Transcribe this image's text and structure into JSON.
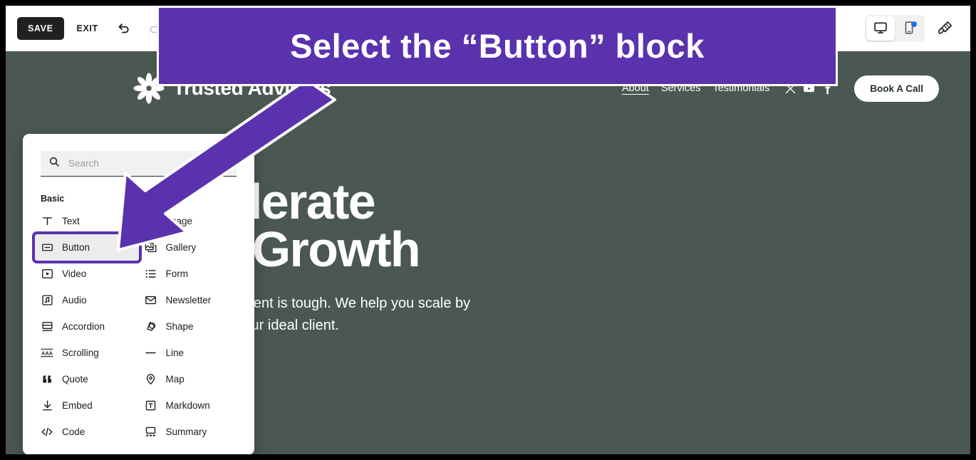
{
  "callout": {
    "text": "Select the “Button” block",
    "bg_color": "#5a32ad",
    "text_color": "#ffffff"
  },
  "toolbar": {
    "save_label": "SAVE",
    "exit_label": "EXIT",
    "undo_icon": "undo-icon",
    "redo_icon": "redo-icon",
    "redo_state": "disabled",
    "desktop_icon": "desktop-icon",
    "mobile_icon": "mobile-icon",
    "mobile_badge_color": "#1a73e8",
    "brush_icon": "paintbrush-icon",
    "active_device": "desktop"
  },
  "site": {
    "bg_color": "#4b5852",
    "logo": {
      "mark": "asterisk-flower-icon",
      "text": "Trusted Advisors"
    },
    "nav": [
      {
        "label": "About",
        "active": true
      },
      {
        "label": "Services",
        "active": false
      },
      {
        "label": "Testimonials",
        "active": false
      }
    ],
    "social": [
      {
        "name": "x-twitter-icon"
      },
      {
        "name": "youtube-icon"
      },
      {
        "name": "facebook-icon"
      }
    ],
    "cta_label": "Book A Call",
    "hero": {
      "heading_line1": "Accelerate",
      "heading_line2": "Your Growth",
      "body": "Finding the right client is tough. We help you scale by connecting with your ideal client."
    }
  },
  "panel": {
    "search": {
      "placeholder": "Search",
      "value": "",
      "icon": "search-icon"
    },
    "section_label": "Basic",
    "selected_block": "Button",
    "selection_color": "#5a32ad",
    "blocks": [
      {
        "label": "Text",
        "icon": "text-icon"
      },
      {
        "label": "Image",
        "icon": "image-icon"
      },
      {
        "label": "Button",
        "icon": "button-icon"
      },
      {
        "label": "Gallery",
        "icon": "gallery-icon"
      },
      {
        "label": "Video",
        "icon": "video-icon"
      },
      {
        "label": "Form",
        "icon": "form-icon"
      },
      {
        "label": "Audio",
        "icon": "audio-icon"
      },
      {
        "label": "Newsletter",
        "icon": "newsletter-icon"
      },
      {
        "label": "Accordion",
        "icon": "accordion-icon"
      },
      {
        "label": "Shape",
        "icon": "shape-icon"
      },
      {
        "label": "Scrolling",
        "icon": "scrolling-icon"
      },
      {
        "label": "Line",
        "icon": "line-icon"
      },
      {
        "label": "Quote",
        "icon": "quote-icon"
      },
      {
        "label": "Map",
        "icon": "map-pin-icon"
      },
      {
        "label": "Embed",
        "icon": "embed-icon"
      },
      {
        "label": "Markdown",
        "icon": "markdown-icon"
      },
      {
        "label": "Code",
        "icon": "code-icon"
      },
      {
        "label": "Summary",
        "icon": "summary-icon"
      }
    ]
  },
  "annotation": {
    "arrow_color": "#5a32ad",
    "arrow_outline": "#ffffff",
    "points_to": "Button"
  }
}
